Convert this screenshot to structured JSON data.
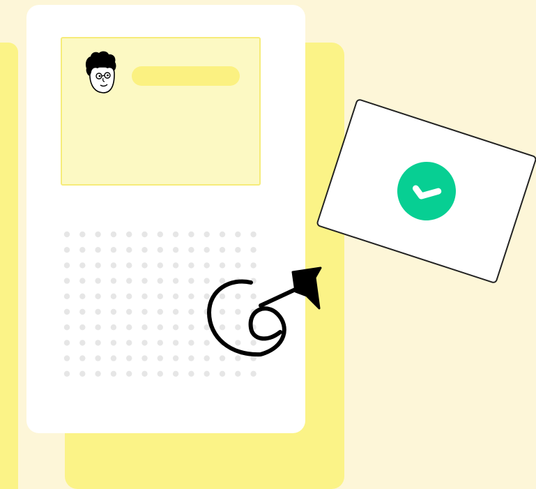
{
  "colors": {
    "background": "#fdf6d8",
    "yellow_panel": "#fbf387",
    "profile_fill": "#fcf9c3",
    "profile_border": "#f6ec7a",
    "name_pill": "#fbf181",
    "dot": "#e6e6e6",
    "check_green": "#07cf93",
    "ink": "#000000"
  },
  "illustration": {
    "avatar": "cartoon-face-avatar",
    "confirmation": "check-circle-icon",
    "doodle": "hand-drawn-loop-arrow"
  },
  "dot_grid": {
    "rows": 10,
    "cols": 13
  }
}
